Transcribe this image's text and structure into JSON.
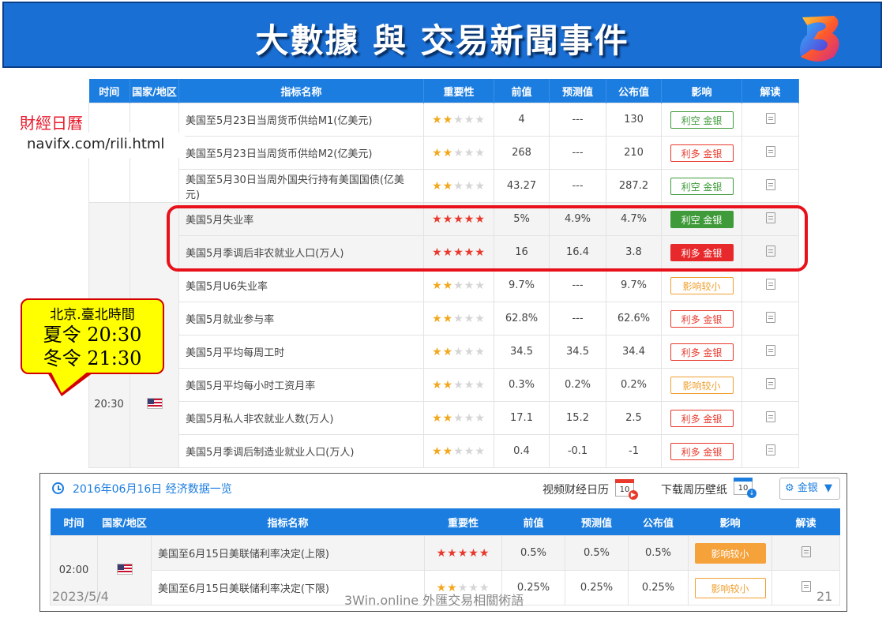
{
  "banner": {
    "title": "大數據 與 交易新聞事件"
  },
  "annotation": {
    "title": "財經日曆",
    "url": "navifx.com/rili.html"
  },
  "callout": {
    "line1": "北京.臺北時間",
    "line2": "夏令 20:30",
    "line3": "冬令 21:30"
  },
  "top_table": {
    "headers": [
      "时间",
      "国家/地区",
      "指标名称",
      "重要性",
      "前值",
      "预测值",
      "公布值",
      "影响",
      "解读"
    ],
    "time": "20:30",
    "rows": [
      {
        "name": "美国至5月23日当周货币供给M1(亿美元)",
        "stars": 2,
        "prev": "4",
        "forecast": "---",
        "actual": "130",
        "impact": "利空 金银",
        "style": "green"
      },
      {
        "name": "美国至5月23日当周货币供给M2(亿美元)",
        "stars": 2,
        "prev": "268",
        "forecast": "---",
        "actual": "210",
        "impact": "利多 金银",
        "style": "red"
      },
      {
        "name": "美国至5月30日当周外国央行持有美国国债(亿美元)",
        "stars": 2,
        "prev": "43.27",
        "forecast": "---",
        "actual": "287.2",
        "impact": "利空 金银",
        "style": "green"
      },
      {
        "name": "美国5月失业率",
        "stars": 5,
        "prev": "5%",
        "forecast": "4.9%",
        "actual": "4.7%",
        "impact": "利空 金银",
        "style": "green-fill"
      },
      {
        "name": "美国5月季调后非农就业人口(万人)",
        "stars": 5,
        "prev": "16",
        "forecast": "16.4",
        "actual": "3.8",
        "impact": "利多 金银",
        "style": "red-fill"
      },
      {
        "name": "美国5月U6失业率",
        "stars": 2,
        "prev": "9.7%",
        "forecast": "---",
        "actual": "9.7%",
        "impact": "影响较小",
        "style": "orange"
      },
      {
        "name": "美国5月就业参与率",
        "stars": 2,
        "prev": "62.8%",
        "forecast": "---",
        "actual": "62.6%",
        "impact": "利多 金银",
        "style": "red"
      },
      {
        "name": "美国5月平均每周工时",
        "stars": 2,
        "prev": "34.5",
        "forecast": "34.5",
        "actual": "34.4",
        "impact": "利多 金银",
        "style": "red"
      },
      {
        "name": "美国5月平均每小时工资月率",
        "stars": 2,
        "prev": "0.3%",
        "forecast": "0.2%",
        "actual": "0.2%",
        "impact": "影响较小",
        "style": "orange"
      },
      {
        "name": "美国5月私人非农就业人数(万人)",
        "stars": 2,
        "prev": "17.1",
        "forecast": "15.2",
        "actual": "2.5",
        "impact": "利多 金银",
        "style": "red"
      },
      {
        "name": "美国5月季调后制造业就业人口(万人)",
        "stars": 2,
        "prev": "0.4",
        "forecast": "-0.1",
        "actual": "-1",
        "impact": "利多 金银",
        "style": "red"
      }
    ]
  },
  "bottom_panel": {
    "date_title": "2016年06月16日 经济数据一览",
    "video_link": "视频财经日历",
    "wallpaper_link": "下载周历壁纸",
    "calendar_day": "10",
    "filter_label": "金银",
    "headers": [
      "时间",
      "国家/地区",
      "指标名称",
      "重要性",
      "前值",
      "预测值",
      "公布值",
      "影响",
      "解读"
    ],
    "time": "02:00",
    "rows": [
      {
        "name": "美国至6月15日美联储利率决定(上限)",
        "stars": 5,
        "prev": "0.5%",
        "forecast": "0.5%",
        "actual": "0.5%",
        "impact": "影响较小",
        "style": "orange-fill"
      },
      {
        "name": "美国至6月15日美联储利率决定(下限)",
        "stars": 2,
        "prev": "0.25%",
        "forecast": "0.25%",
        "actual": "0.25%",
        "impact": "影响较小",
        "style": "orange"
      }
    ]
  },
  "footer": {
    "date": "2023/5/4",
    "center": "3Win.online 外匯交易相關術語",
    "page": "21"
  },
  "colors": {
    "header_blue": "#1b7de0",
    "banner_blue": "#1a6fd4",
    "bull_red": "#e8392c",
    "bear_green": "#3f9b3a",
    "neutral_orange": "#f0a030"
  }
}
